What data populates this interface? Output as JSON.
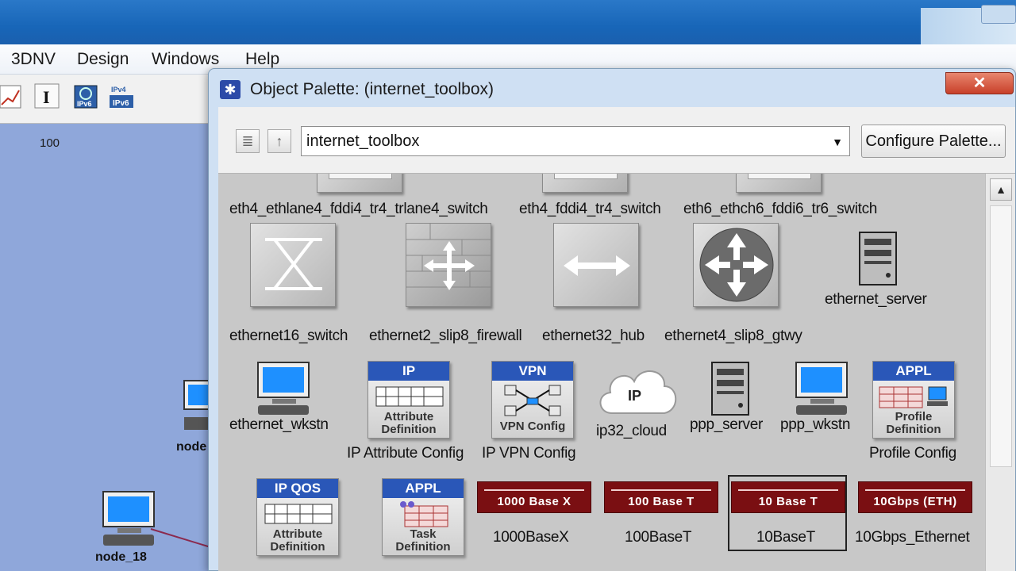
{
  "app": {
    "menu": [
      "3DNV",
      "Design",
      "Windows",
      "Help"
    ],
    "ruler_label": "100",
    "nodes": [
      "node_18",
      "node"
    ]
  },
  "dialog": {
    "title": "Object Palette: (internet_toolbox)",
    "close_glyph": "✕",
    "palette_value": "internet_toolbox",
    "configure_label": "Configure Palette...",
    "row1_labels": [
      "eth4_ethlane4_fddi4_tr4_trlane4_switch",
      "eth4_fddi4_tr4_switch",
      "eth6_ethch6_fddi6_tr6_switch"
    ],
    "row2_labels": [
      "ethernet16_switch",
      "ethernet2_slip8_firewall",
      "ethernet32_hub",
      "ethernet4_slip8_gtwy",
      "ethernet_server"
    ],
    "row3_labels": [
      "ethernet_wkstn",
      "IP Attribute Config",
      "IP VPN Config",
      "ip32_cloud",
      "ppp_server",
      "ppp_wkstn",
      "Profile Config"
    ],
    "row4_labels": [
      "1000BaseX",
      "100BaseT",
      "10BaseT",
      "10Gbps_Ethernet"
    ],
    "card_heads": {
      "ip": "IP",
      "vpn": "VPN",
      "appl": "APPL",
      "ipqos": "IP QOS",
      "appl2": "APPL"
    },
    "card_texts": {
      "attr": "Attribute Definition",
      "vpn": "VPN Config",
      "profile": "Profile Definition",
      "attr2": "Attribute Definition",
      "task": "Task Definition"
    },
    "cloud_text": "IP",
    "cables": [
      "1000 Base X",
      "100 Base T",
      "10 Base T",
      "10Gbps (ETH)"
    ]
  },
  "colors": {
    "accent": "#2a57b8",
    "cable": "#7a0f12",
    "titlebar": "#1866b8"
  }
}
